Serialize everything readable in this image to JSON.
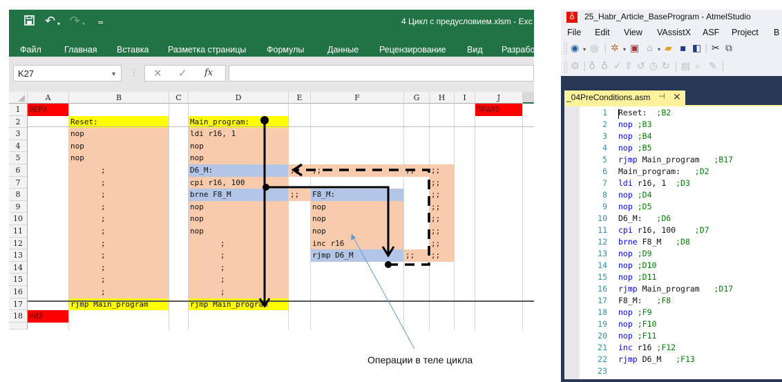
{
  "excel": {
    "document_title": "4 Цикл с предусловием.xlsm - Exc",
    "quick_access": {
      "save_icon": "💾",
      "undo_icon": "↶",
      "redo_icon": "↷",
      "customize_icon": "="
    },
    "ribbon_tabs": [
      "Файл",
      "Главная",
      "Вставка",
      "Разметка страницы",
      "Формулы",
      "Данные",
      "Рецензирование",
      "Вид",
      "Разрабо"
    ],
    "name_box": "K27",
    "formula_buttons": {
      "cancel": "✕",
      "enter": "✓",
      "fx": "fx"
    },
    "formula_value": "",
    "columns": [
      "A",
      "B",
      "C",
      "D",
      "E",
      "F",
      "G",
      "H",
      "I",
      "J"
    ],
    "rows": [
      "1",
      "2",
      "3",
      "4",
      "5",
      "6",
      "7",
      "8",
      "9",
      "10",
      "11",
      "12",
      "13",
      "14",
      "15",
      "16",
      "17",
      "18"
    ],
    "cells": {
      "A1": "ВЕРХ",
      "J1": "ПРАВО",
      "A18": "НИЗ",
      "B2": "Reset:",
      "B3": "nop",
      "B4": "nop",
      "B5": "nop",
      "B6": ";",
      "B7": ";",
      "B8": ";",
      "B9": ";",
      "B10": ";",
      "B11": ";",
      "B12": ";",
      "B13": ";",
      "B14": ";",
      "B15": ";",
      "B16": ";",
      "B17": "rjmp Main_program",
      "D2": "Main_program:",
      "D3": "ldi r16, 1",
      "D4": "nop",
      "D5": "nop",
      "D6": "D6_M:",
      "D7": "cpi r16, 100",
      "D8": "brne F8_M",
      "D9": "nop",
      "D10": "nop",
      "D11": "nop",
      "D12": ";",
      "D13": ";",
      "D14": ";",
      "D15": ";",
      "D16": ";",
      "D17": "rjmp Main_program",
      "E6": ";;",
      "F6": ";;",
      "G6": ";;",
      "H6": ";;",
      "H7": ";;",
      "E8": ";;",
      "H8": ";;",
      "H9": ";;",
      "H10": ";;",
      "H11": ";;",
      "H12": ";;",
      "G13": ";;",
      "H13": ";;",
      "F8": "F8_M:",
      "F9": "nop",
      "F10": "nop",
      "F11": "nop",
      "F12": "inc r16",
      "F13": "rjmp D6_M"
    },
    "callout": "Операции в теле цикла",
    "colors": {
      "header_green": "#217346",
      "marker_red": "#ff0000",
      "label_yellow": "#ffff00",
      "body_peach": "#f8cbad",
      "label_blue": "#b4c6e7"
    }
  },
  "atmel": {
    "window_title": "25_Habr_Article_BaseProgram - AtmelStudio",
    "menu": [
      "File",
      "Edit",
      "View",
      "VAssistX",
      "ASF",
      "Project",
      "B"
    ],
    "file_tab": "_04PreConditions.asm",
    "tab_pin_icon": "⊣",
    "tab_close_icon": "✕",
    "code_lines": [
      {
        "n": "1",
        "kw": "",
        "text": "Reset:  ",
        "comment": ";B2"
      },
      {
        "n": "2",
        "kw": "nop",
        "text": " ",
        "comment": ";B3"
      },
      {
        "n": "3",
        "kw": "nop",
        "text": " ",
        "comment": ";B4"
      },
      {
        "n": "4",
        "kw": "nop",
        "text": " ",
        "comment": ";B5"
      },
      {
        "n": "5",
        "kw": "rjmp",
        "text": " Main_program   ",
        "comment": ";B17"
      },
      {
        "n": "6",
        "kw": "",
        "text": "Main_program:   ",
        "comment": ";D2"
      },
      {
        "n": "7",
        "kw": "ldi",
        "text": " r16, 1  ",
        "comment": ";D3"
      },
      {
        "n": "8",
        "kw": "nop",
        "text": " ",
        "comment": ";D4"
      },
      {
        "n": "9",
        "kw": "nop",
        "text": " ",
        "comment": ";D5"
      },
      {
        "n": "10",
        "kw": "",
        "text": "D6_M:   ",
        "comment": ";D6"
      },
      {
        "n": "11",
        "kw": "cpi",
        "text": " r16, 100    ",
        "comment": ";D7"
      },
      {
        "n": "12",
        "kw": "brne",
        "text": " F8_M   ",
        "comment": ";D8"
      },
      {
        "n": "13",
        "kw": "nop",
        "text": " ",
        "comment": ";D9"
      },
      {
        "n": "14",
        "kw": "nop",
        "text": " ",
        "comment": ";D10"
      },
      {
        "n": "15",
        "kw": "nop",
        "text": " ",
        "comment": ";D11"
      },
      {
        "n": "16",
        "kw": "rjmp",
        "text": " Main_program   ",
        "comment": ";D17"
      },
      {
        "n": "17",
        "kw": "",
        "text": "F8_M:   ",
        "comment": ";F8"
      },
      {
        "n": "18",
        "kw": "nop",
        "text": " ",
        "comment": ";F9"
      },
      {
        "n": "19",
        "kw": "nop",
        "text": " ",
        "comment": ";F10"
      },
      {
        "n": "20",
        "kw": "nop",
        "text": " ",
        "comment": ";F11"
      },
      {
        "n": "21",
        "kw": "inc",
        "text": " r16 ",
        "comment": ";F12"
      },
      {
        "n": "22",
        "kw": "rjmp",
        "text": " D6_M   ",
        "comment": ";F13"
      },
      {
        "n": "23",
        "kw": "",
        "text": "",
        "comment": ""
      }
    ],
    "colors": {
      "keyword": "#0000ff",
      "comment": "#008000",
      "line_number": "#2b91af",
      "tab_yellow": "#fff29d",
      "chrome_dark": "#293955"
    }
  }
}
